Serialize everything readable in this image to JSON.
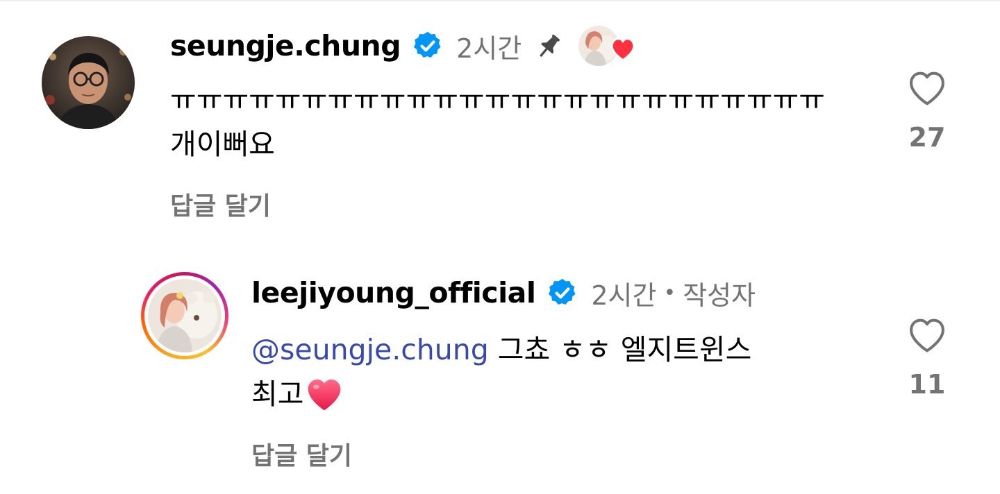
{
  "comments": [
    {
      "username": "seungje.chung",
      "verified": true,
      "time": "2시간",
      "pinned": true,
      "liked_by_author": true,
      "lines": [
        "ㅠㅠㅠㅠㅠㅠㅠㅠㅠㅠㅠㅠㅠㅠㅠㅠㅠㅠㅠㅠㅠㅠㅠㅠㅠ",
        "개이뻐요"
      ],
      "reply_label": "답글 달기",
      "like_count": "27"
    },
    {
      "username": "leejiyoung_official",
      "verified": true,
      "time": "2시간",
      "author_badge": "작성자",
      "mention": "@seungje.chung",
      "text_after_mention": " 그쵸 ㅎㅎ 엘지트윈스",
      "line2": "최고",
      "line2_emoji": "heart",
      "reply_label": "답글 달기",
      "like_count": "11"
    }
  ],
  "colors": {
    "verified_blue": "#0095f6",
    "meta_gray": "#737373",
    "mention_blue": "#3949ab",
    "heart_red": "#ff3040"
  }
}
